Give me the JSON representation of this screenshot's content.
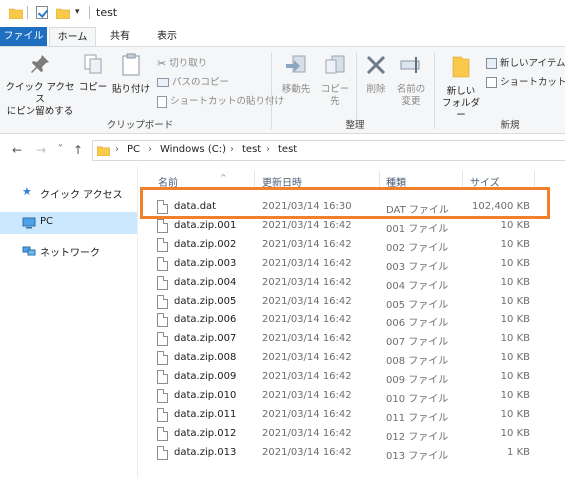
{
  "window": {
    "title": "test",
    "dropdown_glyph": "▾"
  },
  "ribbon_tabs": [
    "ファイル",
    "ホーム",
    "共有",
    "表示"
  ],
  "ribbon": {
    "clipboard": {
      "pin_label_1": "クイック アクセス",
      "pin_label_2": "にピン留めする",
      "copy": "コピー",
      "paste": "貼り付け",
      "cut": "切り取り",
      "copy_path": "パスのコピー",
      "paste_shortcut": "ショートカットの貼り付け",
      "group_label": "クリップボード"
    },
    "organize": {
      "move_to": "移動先",
      "copy_to": "コピー先",
      "delete": "削除",
      "rename_1": "名前の",
      "rename_2": "変更",
      "group_label": "整理"
    },
    "new": {
      "new_folder_1": "新しい",
      "new_folder_2": "フォルダー",
      "new_item": "新しいアイテム",
      "shortcut": "ショートカット",
      "group_label": "新規"
    }
  },
  "address": {
    "crumbs": [
      "PC",
      "Windows (C:)",
      "test",
      "test"
    ],
    "chevron": "›"
  },
  "nav": {
    "back": "←",
    "forward": "→",
    "recent": "˅",
    "up": "↑",
    "items": [
      "クイック アクセス",
      "PC",
      "ネットワーク"
    ]
  },
  "columns": {
    "name": "名前",
    "date": "更新日時",
    "type": "種類",
    "size": "サイズ",
    "sort_caret": "^"
  },
  "files": [
    {
      "name": "data.dat",
      "date": "2021/03/14 16:30",
      "type": "DAT ファイル",
      "size": "102,400 KB"
    },
    {
      "name": "data.zip.001",
      "date": "2021/03/14 16:42",
      "type": "001 ファイル",
      "size": "10 KB"
    },
    {
      "name": "data.zip.002",
      "date": "2021/03/14 16:42",
      "type": "002 ファイル",
      "size": "10 KB"
    },
    {
      "name": "data.zip.003",
      "date": "2021/03/14 16:42",
      "type": "003 ファイル",
      "size": "10 KB"
    },
    {
      "name": "data.zip.004",
      "date": "2021/03/14 16:42",
      "type": "004 ファイル",
      "size": "10 KB"
    },
    {
      "name": "data.zip.005",
      "date": "2021/03/14 16:42",
      "type": "005 ファイル",
      "size": "10 KB"
    },
    {
      "name": "data.zip.006",
      "date": "2021/03/14 16:42",
      "type": "006 ファイル",
      "size": "10 KB"
    },
    {
      "name": "data.zip.007",
      "date": "2021/03/14 16:42",
      "type": "007 ファイル",
      "size": "10 KB"
    },
    {
      "name": "data.zip.008",
      "date": "2021/03/14 16:42",
      "type": "008 ファイル",
      "size": "10 KB"
    },
    {
      "name": "data.zip.009",
      "date": "2021/03/14 16:42",
      "type": "009 ファイル",
      "size": "10 KB"
    },
    {
      "name": "data.zip.010",
      "date": "2021/03/14 16:42",
      "type": "010 ファイル",
      "size": "10 KB"
    },
    {
      "name": "data.zip.011",
      "date": "2021/03/14 16:42",
      "type": "011 ファイル",
      "size": "10 KB"
    },
    {
      "name": "data.zip.012",
      "date": "2021/03/14 16:42",
      "type": "012 ファイル",
      "size": "10 KB"
    },
    {
      "name": "data.zip.013",
      "date": "2021/03/14 16:42",
      "type": "013 ファイル",
      "size": "1 KB"
    }
  ],
  "colors": {
    "accent": "#1e6fc0",
    "highlight_box": "#f0802a",
    "selection": "#cce8ff"
  }
}
